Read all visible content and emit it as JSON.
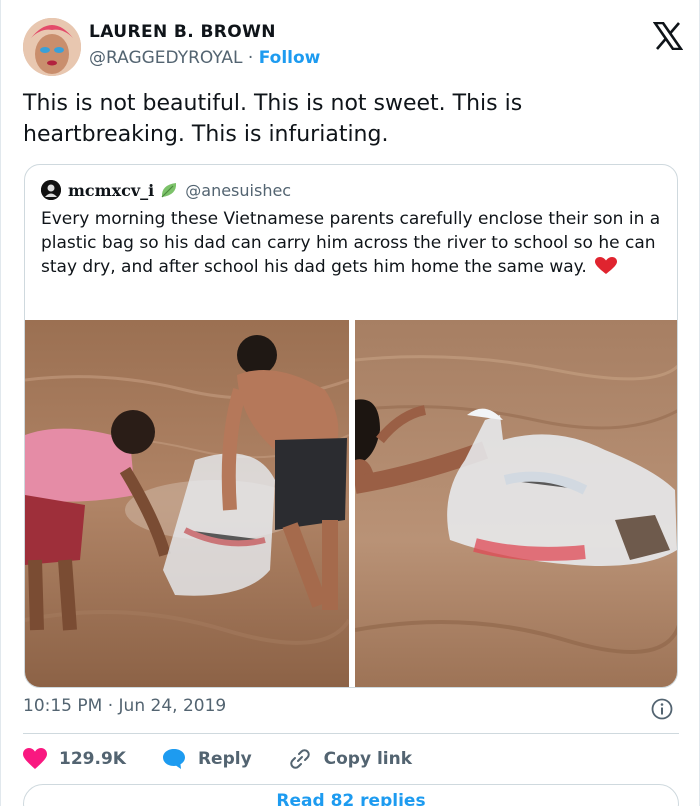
{
  "author": {
    "name": "LAUREN B. BROWN",
    "handle": "@RAGGEDYROYAL",
    "separator": "·",
    "follow_label": "Follow"
  },
  "tweet": {
    "text": "This is not beautiful. This is not sweet. This is heartbreaking. This is infuriating."
  },
  "quote": {
    "name": "mcmxcv_i",
    "handle": "@anesuishec",
    "text": "Every morning these Vietnamese parents carefully enclose their son in a plastic bag so his dad can carry him across the river to school so he can stay dry, and after school his dad gets him home the same way.",
    "emoji": "red-heart"
  },
  "meta": {
    "time": "10:15 PM",
    "separator": "·",
    "date": "Jun 24, 2019"
  },
  "actions": {
    "likes": "129.9K",
    "reply_label": "Reply",
    "copy_label": "Copy link"
  },
  "read_replies_label": "Read 82 replies",
  "icons": {
    "brand": "x-logo-icon",
    "verified_leaf": "leaf-icon",
    "info": "info-icon",
    "like": "heart-icon",
    "reply": "reply-bubble-icon",
    "copy": "link-icon"
  },
  "colors": {
    "accent": "#1d9bf0",
    "like": "#f91880",
    "text": "#0f1419",
    "secondary": "#536471",
    "border": "#cfd9de"
  }
}
